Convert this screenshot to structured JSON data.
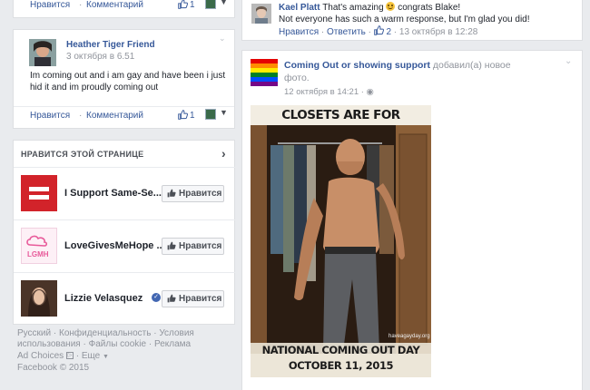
{
  "left": {
    "top_actions": {
      "like": "Нравится",
      "comment": "Комментарий",
      "count": "1"
    },
    "heather": {
      "name": "Heather Tiger Friend",
      "date": "3 октября в 6.51",
      "text": "Im coming out and i am gay and have been i just hid it and im proudly coming out",
      "like": "Нравится",
      "comment": "Комментарий",
      "count": "1"
    },
    "pages_header": "НРАВИТСЯ ЭТОЙ СТРАНИЦЕ",
    "pages": [
      {
        "name": "I Support Same-Se...",
        "button": "Нравится"
      },
      {
        "name": "LoveGivesMeHope ...",
        "button": "Нравится",
        "logo_text": "LGMH"
      },
      {
        "name": "Lizzie Velasquez",
        "button": "Нравится"
      }
    ],
    "footer": {
      "items": [
        "Русский",
        "Конфиденциальность",
        "Условия",
        "использования",
        "Файлы cookie",
        "Реклама",
        "Ad Choices",
        "Еще"
      ],
      "copyright": "Facebook © 2015"
    }
  },
  "right": {
    "comment": {
      "author": "Kael Platt",
      "text_before": "That's amazing ",
      "text_after": " congrats Blake!",
      "line2": "Not everyone has such a warm response, but I'm glad you did!",
      "like": "Нравится",
      "reply": "Ответить",
      "count": "2",
      "time": "13 октября в 12:28"
    },
    "post": {
      "page": "Coming Out or showing support",
      "action": "добавил(а) новое фото.",
      "time": "12 октября в 14:21",
      "image_top": "CLOSETS ARE FOR CLOTHES",
      "image_url": "haveagayday.org",
      "image_bottom1": "NATIONAL COMING OUT DAY",
      "image_bottom2": "OCTOBER 11, 2015"
    }
  },
  "colors": {
    "link": "#365899",
    "equality_red": "#d2232a",
    "lgmh_pink": "#e85a9a"
  }
}
